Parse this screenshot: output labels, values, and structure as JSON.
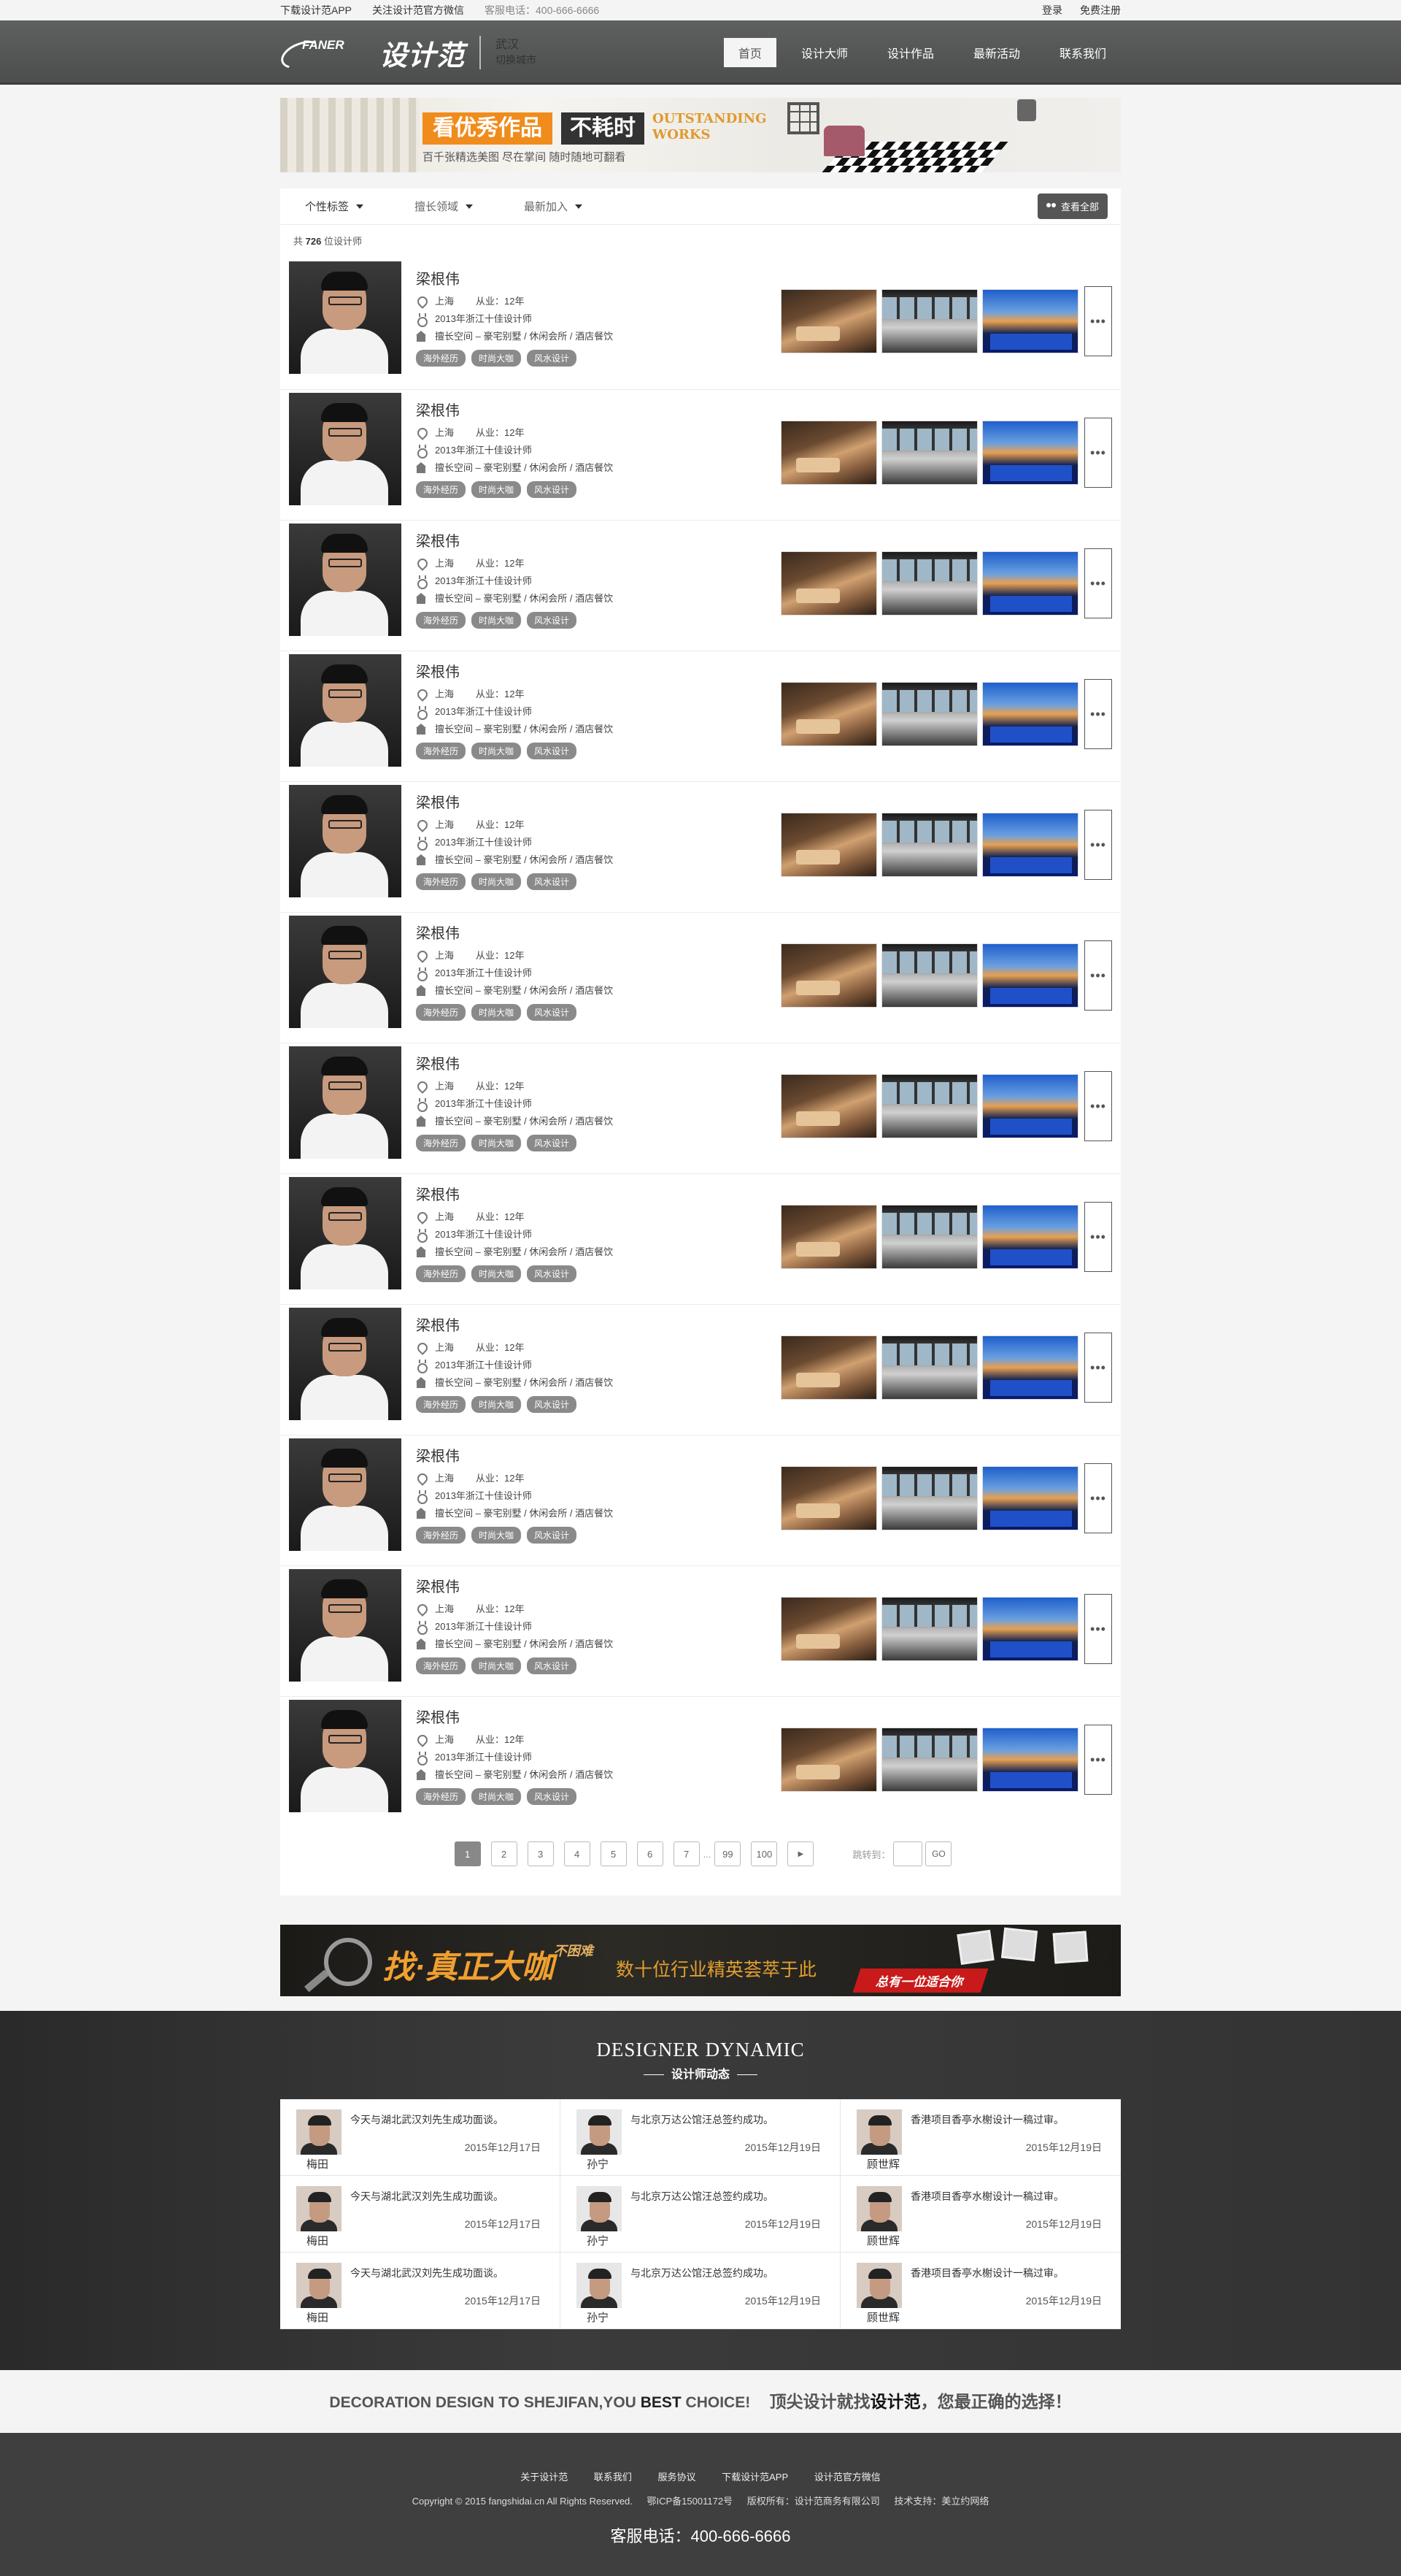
{
  "topbar": {
    "app": "下载设计范APP",
    "wechat": "关注设计范官方微信",
    "service": "客服电话：400-666-6666",
    "login": "登录",
    "register": "免费注册"
  },
  "header": {
    "logo_en": "FANER",
    "logo_cn": "设计范",
    "city": "武汉",
    "switch_city": "切换城市",
    "nav": [
      "首页",
      "设计大师",
      "设计作品",
      "最新活动",
      "联系我们"
    ]
  },
  "banner": {
    "tag1": "看优秀作品",
    "tag2": "不耗时",
    "tag3": "OUTSTANDING WORKS",
    "sub": "百千张精选美图  尽在掌间  随时随地可翻看"
  },
  "filter": {
    "items": [
      "个性标签",
      "擅长领域",
      "最新加入"
    ],
    "view_all": "查看全部"
  },
  "count": {
    "prefix": "共",
    "num": "726",
    "suffix": "位设计师"
  },
  "designer": {
    "name": "梁根伟",
    "city": "上海",
    "years": "从业：12年",
    "award": "2013年浙江十佳设计师",
    "fields": "擅长空间 – 豪宅别墅 / 休闲会所 / 酒店餐饮",
    "tags": [
      "海外经历",
      "时尚大咖",
      "风水设计"
    ],
    "more": "•••"
  },
  "rows": 12,
  "pager": {
    "pages": [
      "1",
      "2",
      "3",
      "4",
      "5",
      "6",
      "7"
    ],
    "dots": "...",
    "tail": [
      "99",
      "100"
    ],
    "next": "▶",
    "jump_label": "跳转到：",
    "go": "GO"
  },
  "ad2": {
    "t1": "找·真正大咖",
    "t1b": "不困难",
    "t2": "数十位行业精英荟萃于此",
    "t3": "总有一位适合你"
  },
  "dynamic": {
    "title_en": "DESIGNER DYNAMIC",
    "title_cn": "设计师动态",
    "items": [
      {
        "name": "梅田",
        "msg": "今天与湖北武汉刘先生成功面谈。",
        "date": "2015年12月17日"
      },
      {
        "name": "孙宁",
        "msg": "与北京万达公馆汪总签约成功。",
        "date": "2015年12月19日"
      },
      {
        "name": "顾世辉",
        "msg": "香港项目香亭水榭设计一稿过审。",
        "date": "2015年12月19日"
      },
      {
        "name": "梅田",
        "msg": "今天与湖北武汉刘先生成功面谈。",
        "date": "2015年12月17日"
      },
      {
        "name": "孙宁",
        "msg": "与北京万达公馆汪总签约成功。",
        "date": "2015年12月19日"
      },
      {
        "name": "顾世辉",
        "msg": "香港项目香亭水榭设计一稿过审。",
        "date": "2015年12月19日"
      },
      {
        "name": "梅田",
        "msg": "今天与湖北武汉刘先生成功面谈。",
        "date": "2015年12月17日"
      },
      {
        "name": "孙宁",
        "msg": "与北京万达公馆汪总签约成功。",
        "date": "2015年12月19日"
      },
      {
        "name": "顾世辉",
        "msg": "香港项目香亭水榭设计一稿过审。",
        "date": "2015年12月19日"
      }
    ]
  },
  "slogan": {
    "en1": "DECORATION DESIGN TO SHEJIFAN,YOU ",
    "best": "BEST",
    "en2": " CHOICE!",
    "cn1": "顶尖设计就找",
    "brand": "设计范",
    "cn2": "，您最正确的选择！"
  },
  "footer": {
    "links": [
      "关于设计范",
      "联系我们",
      "服务协议",
      "下载设计范APP",
      "设计范官方微信"
    ],
    "copyright": "Copyright © 2015 fangshidai.cn All Rights Reserved.",
    "icp": "鄂ICP备15001172号",
    "owner": "版权所有：设计范商务有限公司",
    "support": "技术支持：美立约网络",
    "tel": "客服电话：400-666-6666"
  },
  "colors": {
    "header": "#555555",
    "accent": "#f08c1c",
    "tag": "#8a8a8a"
  }
}
